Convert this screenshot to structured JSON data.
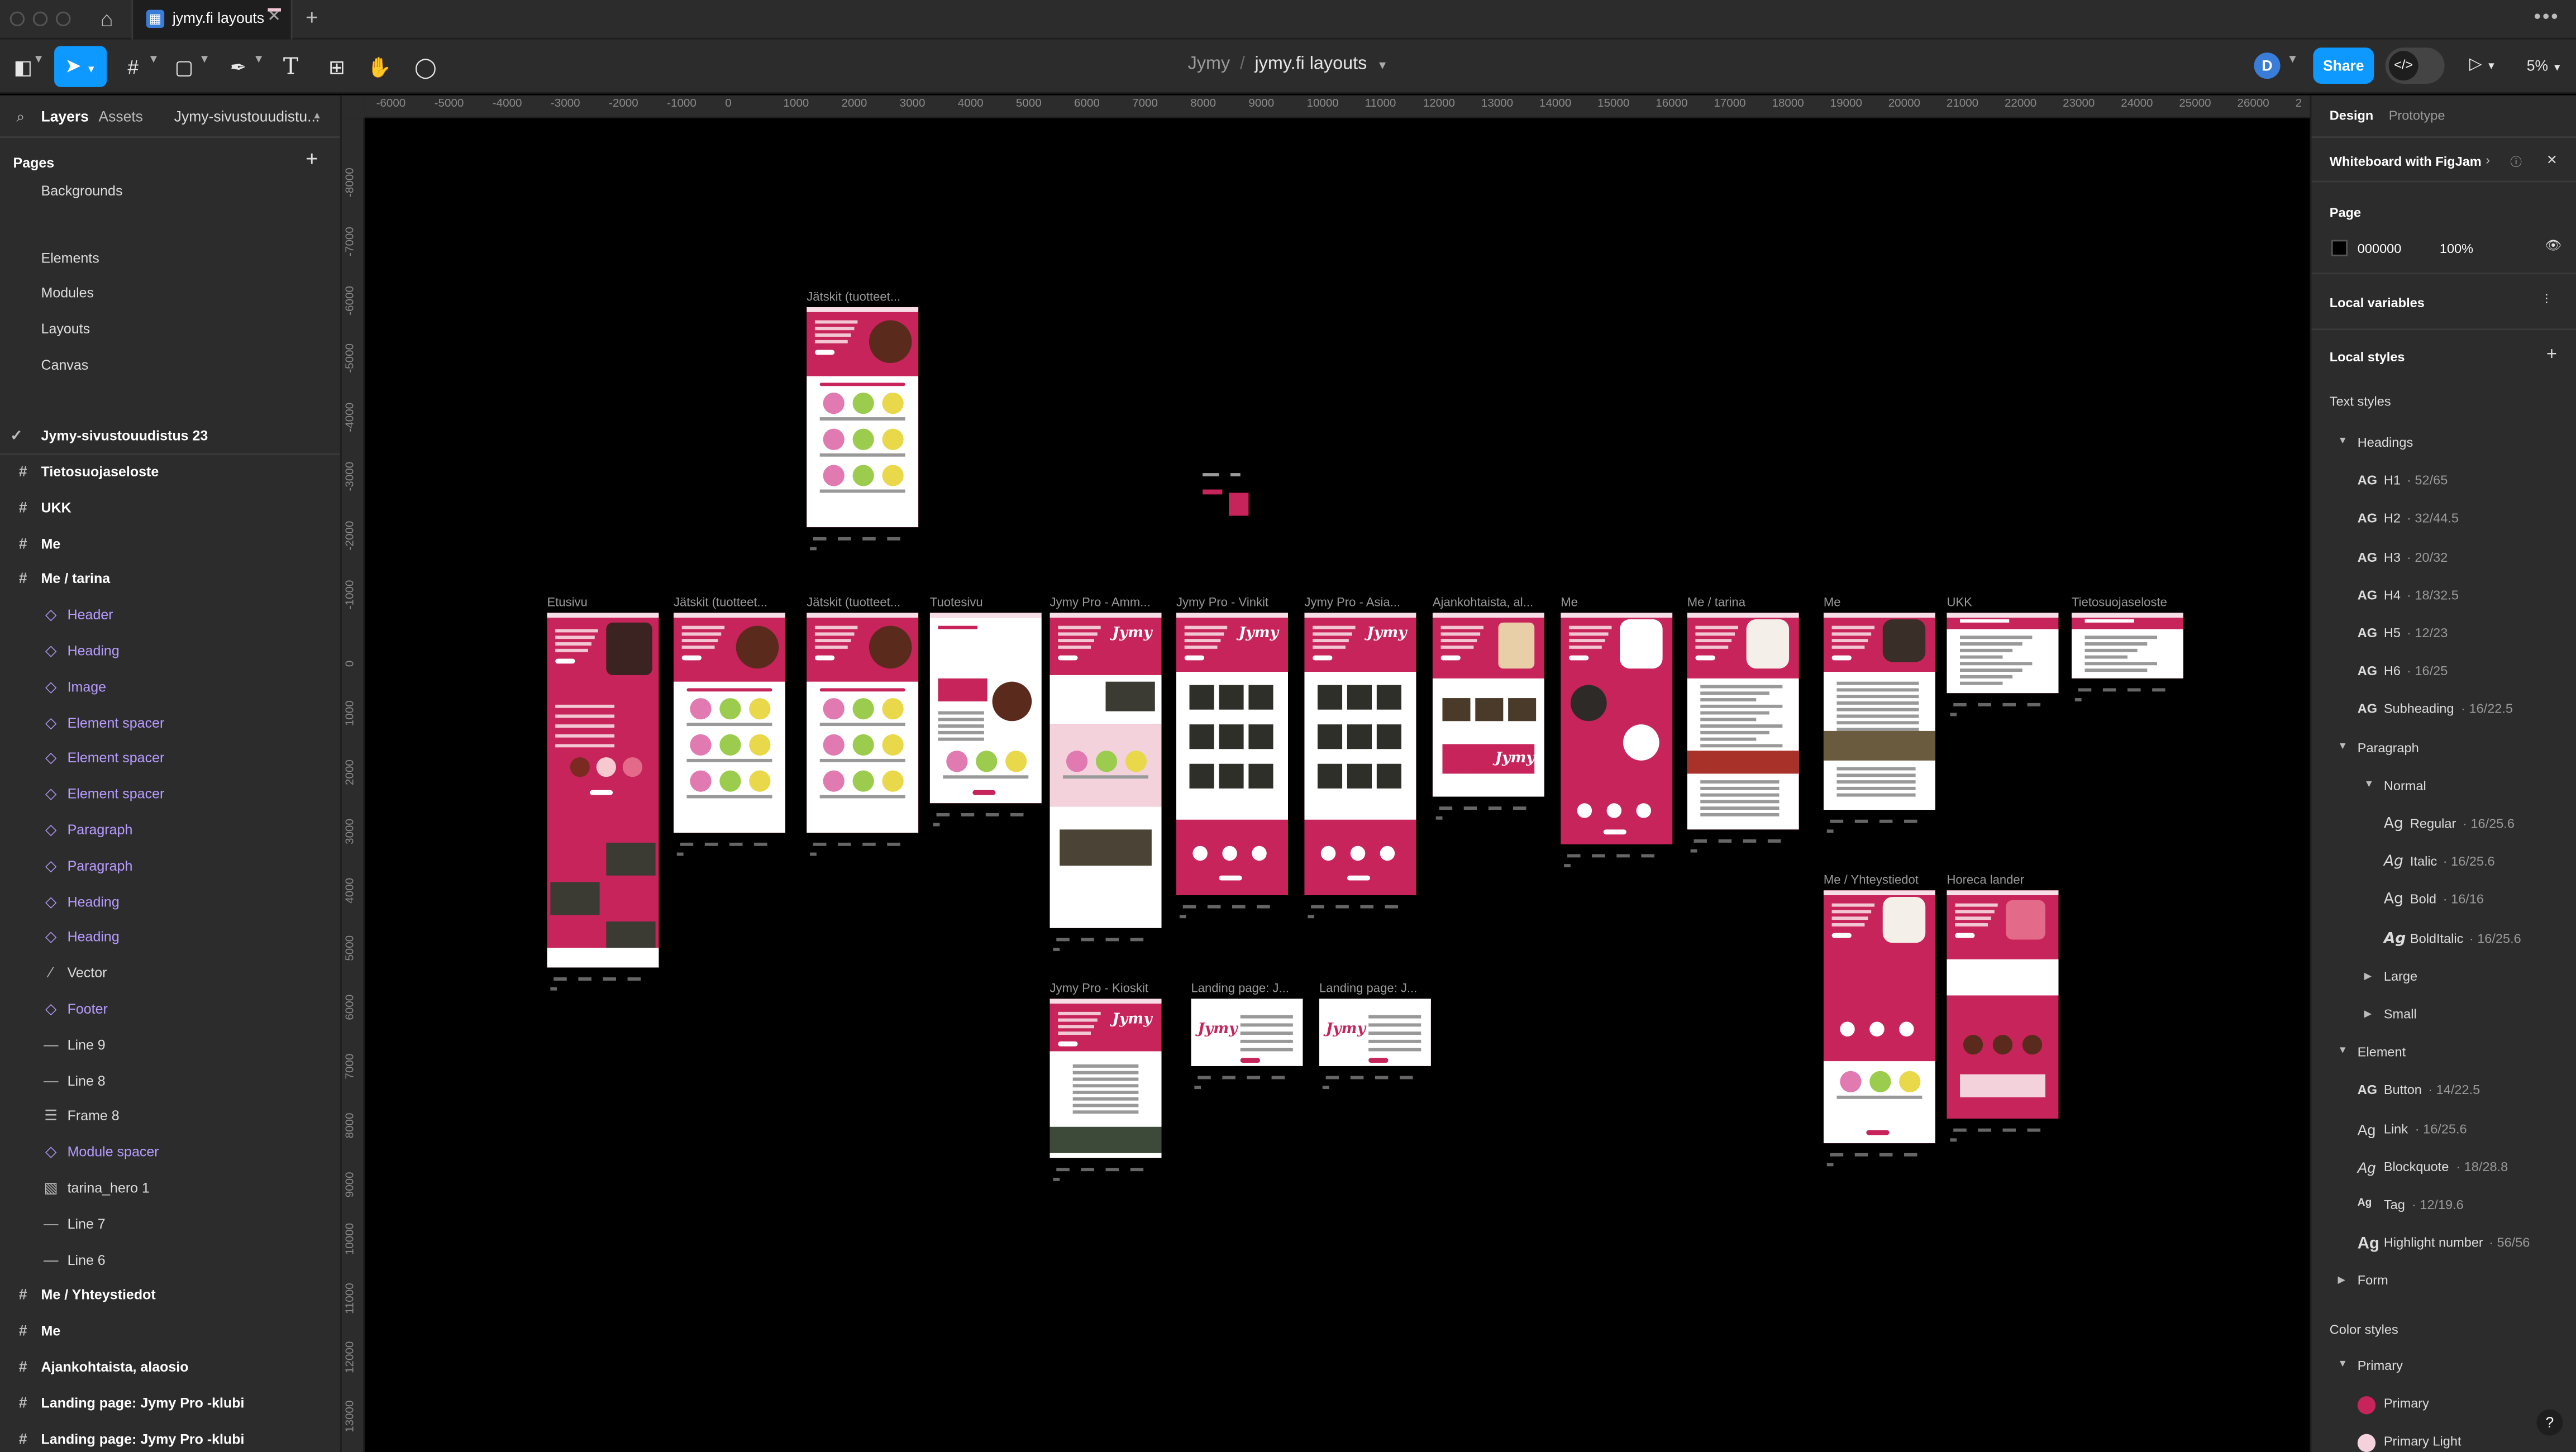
{
  "window": {
    "tab_title": "jymy.fi layouts"
  },
  "breadcrumb": {
    "project": "Jymy",
    "separator": "/",
    "file": "jymy.fi layouts"
  },
  "header": {
    "avatar_letter": "D",
    "share_label": "Share",
    "zoom": "5%"
  },
  "left_panel": {
    "tab_layers": "Layers",
    "tab_assets": "Assets",
    "current_page": "Jymy-sivustouudistu...",
    "pages_heading": "Pages",
    "pages": [
      "Backgrounds",
      "Elements",
      "Modules",
      "Layouts",
      "Canvas",
      "Jymy-sivustouudistus 23"
    ],
    "layers": [
      {
        "kind": "frame",
        "label": "Tietosuojaseloste"
      },
      {
        "kind": "frame",
        "label": "UKK"
      },
      {
        "kind": "frame",
        "label": "Me"
      },
      {
        "kind": "frame",
        "label": "Me / tarina"
      },
      {
        "kind": "component",
        "label": "Header"
      },
      {
        "kind": "component",
        "label": "Heading"
      },
      {
        "kind": "component",
        "label": "Image"
      },
      {
        "kind": "component",
        "label": "Element spacer"
      },
      {
        "kind": "component",
        "label": "Element spacer"
      },
      {
        "kind": "component",
        "label": "Element spacer"
      },
      {
        "kind": "component",
        "label": "Paragraph"
      },
      {
        "kind": "component",
        "label": "Paragraph"
      },
      {
        "kind": "component",
        "label": "Heading"
      },
      {
        "kind": "component",
        "label": "Heading"
      },
      {
        "kind": "vector",
        "label": "Vector"
      },
      {
        "kind": "component",
        "label": "Footer"
      },
      {
        "kind": "line",
        "label": "Line 9"
      },
      {
        "kind": "line",
        "label": "Line 8"
      },
      {
        "kind": "autolayout",
        "label": "Frame 8"
      },
      {
        "kind": "component",
        "label": "Module spacer"
      },
      {
        "kind": "image",
        "label": "tarina_hero 1"
      },
      {
        "kind": "line",
        "label": "Line 7"
      },
      {
        "kind": "line",
        "label": "Line 6"
      },
      {
        "kind": "frame",
        "label": "Me / Yhteystiedot"
      },
      {
        "kind": "frame",
        "label": "Me"
      },
      {
        "kind": "frame",
        "label": "Ajankohtaista, alaosio"
      },
      {
        "kind": "frame",
        "label": "Landing page: Jymy Pro -klubi"
      },
      {
        "kind": "frame",
        "label": "Landing page: Jymy Pro -klubi"
      }
    ]
  },
  "rulers": {
    "top": [
      "-6000",
      "-5000",
      "-4000",
      "-3000",
      "-2000",
      "-1000",
      "0",
      "1000",
      "2000",
      "3000",
      "4000",
      "5000",
      "6000",
      "7000",
      "8000",
      "9000",
      "10000",
      "11000",
      "12000",
      "13000",
      "14000",
      "15000",
      "16000",
      "17000",
      "18000",
      "19000",
      "20000",
      "21000",
      "22000",
      "23000",
      "24000",
      "25000",
      "26000",
      "2"
    ],
    "left": [
      "-8000",
      "-7000",
      "-6000",
      "-5000",
      "-4000",
      "-3000",
      "-2000",
      "-1000",
      "0",
      "1000",
      "2000",
      "3000",
      "4000",
      "5000",
      "6000",
      "7000",
      "8000",
      "9000",
      "10000",
      "11000",
      "12000",
      "13000"
    ]
  },
  "canvas_frames": [
    {
      "label": "Jätskit (tuotteet..."
    },
    {
      "label": "Etusivu"
    },
    {
      "label": "Jätskit (tuotteet..."
    },
    {
      "label": "Jätskit (tuotteet..."
    },
    {
      "label": "Tuotesivu"
    },
    {
      "label": "Jymy Pro - Amm..."
    },
    {
      "label": "Jymy Pro - Vinkit"
    },
    {
      "label": "Jymy Pro - Asia..."
    },
    {
      "label": "Ajankohtaista, al..."
    },
    {
      "label": "Me"
    },
    {
      "label": "Me / tarina"
    },
    {
      "label": "Me"
    },
    {
      "label": "UKK"
    },
    {
      "label": "Tietosuojaseloste"
    },
    {
      "label": "Jymy Pro - Kioskit"
    },
    {
      "label": "Landing page: J..."
    },
    {
      "label": "Landing page: J..."
    },
    {
      "label": "Me / Yhteystiedot"
    },
    {
      "label": "Horeca lander"
    }
  ],
  "right_panel": {
    "tab_design": "Design",
    "tab_prototype": "Prototype",
    "banner": "Whiteboard with FigJam",
    "page_heading": "Page",
    "page_color_hex": "000000",
    "page_color": "#000000",
    "page_opacity": "100%",
    "local_variables": "Local variables",
    "local_styles": "Local styles",
    "text_styles_heading": "Text styles",
    "headings_group": "Headings",
    "headings": [
      {
        "name": "H1",
        "spec": "52/65"
      },
      {
        "name": "H2",
        "spec": "32/44.5"
      },
      {
        "name": "H3",
        "spec": "20/32"
      },
      {
        "name": "H4",
        "spec": "18/32.5"
      },
      {
        "name": "H5",
        "spec": "12/23"
      },
      {
        "name": "H6",
        "spec": "16/25"
      },
      {
        "name": "Subheading",
        "spec": "16/22.5"
      }
    ],
    "paragraph_group": "Paragraph",
    "normal_group": "Normal",
    "normal_styles": [
      {
        "name": "Regular",
        "spec": "16/25.6"
      },
      {
        "name": "Italic",
        "spec": "16/25.6"
      },
      {
        "name": "Bold",
        "spec": "16/16"
      },
      {
        "name": "BoldItalic",
        "spec": "16/25.6"
      }
    ],
    "large_group": "Large",
    "small_group": "Small",
    "element_group": "Element",
    "element_styles": [
      {
        "name": "Button",
        "spec": "14/22.5"
      },
      {
        "name": "Link",
        "spec": "16/25.6"
      },
      {
        "name": "Blockquote",
        "spec": "18/28.8"
      },
      {
        "name": "Tag",
        "spec": "12/19.6"
      },
      {
        "name": "Highlight number",
        "spec": "56/56"
      }
    ],
    "form_group": "Form",
    "color_styles_heading": "Color styles",
    "primary_group": "Primary",
    "colors": [
      {
        "name": "Primary",
        "hex": "#c6245a"
      },
      {
        "name": "Primary Light",
        "hex": "#f3d2dc"
      }
    ],
    "help": "?"
  },
  "colors": {
    "brand_magenta": "#c6245a",
    "figma_blue": "#0d99ff",
    "panel_bg": "#2c2c2c"
  }
}
